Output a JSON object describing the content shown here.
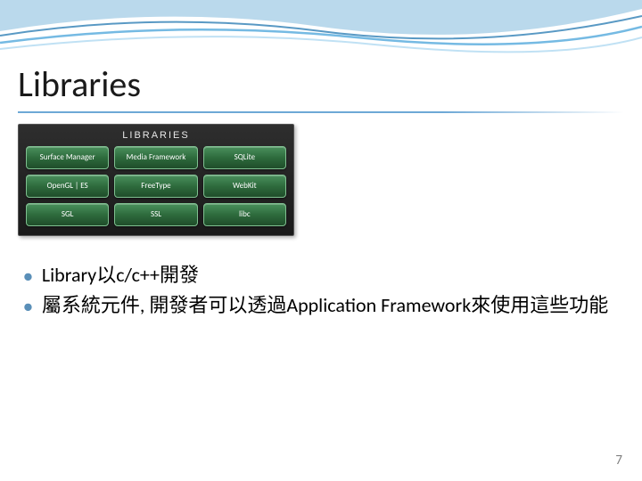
{
  "slide": {
    "title": "Libraries",
    "page_number": "7"
  },
  "lib_panel": {
    "header": "Libraries",
    "cells": [
      "Surface Manager",
      "Media Framework",
      "SQLite",
      "OpenGL | ES",
      "FreeType",
      "WebKit",
      "SGL",
      "SSL",
      "libc"
    ]
  },
  "bullets": [
    "Library以c/c++開發",
    "屬系統元件, 開發者可以透過Application Framework來使用這些功能"
  ]
}
